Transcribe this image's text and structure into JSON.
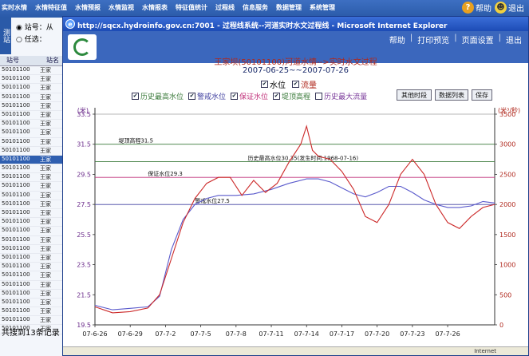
{
  "bg_app": {
    "nav": [
      "实时水情",
      "水情特征值",
      "水情预报",
      "水情监视",
      "水情报表",
      "特征值统计",
      "过程线",
      "信息服务",
      "数据管理",
      "系统管理"
    ],
    "help_label": "帮助",
    "exit_label": "退出",
    "side_tab": "测站",
    "radio_station": "站号：从",
    "radio_any": "任选：",
    "table_headers": [
      "站号",
      "站名"
    ],
    "rows": [
      {
        "code": "50101100",
        "name": "王家"
      },
      {
        "code": "50101100",
        "name": "王家"
      },
      {
        "code": "50101100",
        "name": "王家"
      },
      {
        "code": "50101100",
        "name": "王家"
      },
      {
        "code": "50101100",
        "name": "王家"
      },
      {
        "code": "50101100",
        "name": "王家"
      },
      {
        "code": "50101100",
        "name": "王家"
      },
      {
        "code": "50101100",
        "name": "王家"
      },
      {
        "code": "50101100",
        "name": "王家"
      },
      {
        "code": "50101100",
        "name": "王家"
      },
      {
        "code": "50101100",
        "name": "王家"
      },
      {
        "code": "50101100",
        "name": "王家"
      },
      {
        "code": "50101100",
        "name": "王家"
      },
      {
        "code": "50101100",
        "name": "王家"
      },
      {
        "code": "50101100",
        "name": "王家"
      },
      {
        "code": "50101100",
        "name": "王家"
      },
      {
        "code": "50101100",
        "name": "王家"
      },
      {
        "code": "50101100",
        "name": "王家"
      },
      {
        "code": "50101100",
        "name": "王家"
      },
      {
        "code": "50101100",
        "name": "王家"
      },
      {
        "code": "50101100",
        "name": "王家"
      },
      {
        "code": "50101100",
        "name": "王家"
      },
      {
        "code": "50101100",
        "name": "王家"
      },
      {
        "code": "50101100",
        "name": "王家"
      },
      {
        "code": "50101100",
        "name": "王家"
      },
      {
        "code": "50101100",
        "name": "王家"
      },
      {
        "code": "50101100",
        "name": "王家"
      },
      {
        "code": "50101100",
        "name": "王家"
      },
      {
        "code": "50101100",
        "name": "王家"
      },
      {
        "code": "50101100",
        "name": "王家"
      }
    ],
    "status": "共搜到13条记录"
  },
  "window": {
    "title": "http://sqcx.hydroinfo.gov.cn:7001 - 过程线系统--河道实时水文过程线 - Microsoft Internet Explorer",
    "links": [
      "帮助",
      "|",
      "打印预览",
      "|",
      "页面设置",
      "|",
      "退出"
    ],
    "status_zone": "Internet"
  },
  "controls": {
    "chart_title": "王家坝(50101100)河道水情-->实时水文过程",
    "date_range": "2007-06-25~~2007-07-26",
    "check_level": "水位",
    "check_flow": "流量",
    "check_hist_high": "历史最高水位",
    "check_warn": "警戒水位",
    "check_guar": "保证水位",
    "check_dike": "堤顶高程",
    "check_hist_max_flow": "历史最大流量",
    "btn_other": "其他时段",
    "btn_list": "数据列表",
    "btn_save": "保存"
  },
  "chart_data": {
    "type": "line",
    "x": [
      "07-6-26",
      "07-6-29",
      "07-7-2",
      "07-7-5",
      "07-7-8",
      "07-7-11",
      "07-7-14",
      "07-7-17",
      "07-7-20",
      "07-7-23",
      "07-7-26"
    ],
    "y_left_unit": "(米)",
    "y_right_unit": "(米³/秒)",
    "ylim_left": [
      19.5,
      33.5
    ],
    "ylim_right": [
      0,
      3500
    ],
    "yticks_left": [
      19.5,
      21.5,
      23.5,
      25.5,
      27.5,
      29.5,
      31.5,
      33.5
    ],
    "yticks_right": [
      0,
      500,
      1000,
      1500,
      2000,
      2500,
      3000,
      3500
    ],
    "reference_lines": [
      {
        "name": "堤顶高程",
        "value": 31.5,
        "label": "堤顶高程31.5",
        "color": "#3a7a3a"
      },
      {
        "name": "历史最高水位",
        "value": 30.35,
        "label": "历史最高水位30.35(发生时间:1968-07-16)",
        "color": "#3a7a3a"
      },
      {
        "name": "保证水位",
        "value": 29.3,
        "label": "保证水位29.3",
        "color": "#c0307a"
      },
      {
        "name": "警戒水位",
        "value": 27.5,
        "label": "警戒水位27.5",
        "color": "#4040a0"
      }
    ],
    "series": [
      {
        "name": "水位",
        "axis": "left",
        "color": "#5a5acc",
        "points": [
          [
            0,
            20.8
          ],
          [
            1.5,
            20.5
          ],
          [
            3,
            20.6
          ],
          [
            4.5,
            20.7
          ],
          [
            5.5,
            21.4
          ],
          [
            6.5,
            24.5
          ],
          [
            7.5,
            26.5
          ],
          [
            8.5,
            27.5
          ],
          [
            9.5,
            27.9
          ],
          [
            10.5,
            28.1
          ],
          [
            12,
            28.1
          ],
          [
            13.5,
            28.2
          ],
          [
            15,
            28.5
          ],
          [
            16.5,
            28.9
          ],
          [
            18,
            29.2
          ],
          [
            19,
            29.2
          ],
          [
            20,
            29.0
          ],
          [
            21,
            28.6
          ],
          [
            22,
            28.2
          ],
          [
            23,
            28.0
          ],
          [
            24,
            28.3
          ],
          [
            25,
            28.7
          ],
          [
            26,
            28.7
          ],
          [
            27,
            28.3
          ],
          [
            28,
            27.8
          ],
          [
            29,
            27.5
          ],
          [
            30,
            27.3
          ],
          [
            31,
            27.3
          ],
          [
            32,
            27.4
          ],
          [
            33,
            27.7
          ],
          [
            34,
            27.6
          ]
        ]
      },
      {
        "name": "流量",
        "axis": "right",
        "color": "#cc2a2a",
        "points": [
          [
            0,
            300
          ],
          [
            1.5,
            200
          ],
          [
            3,
            220
          ],
          [
            4.5,
            280
          ],
          [
            5.5,
            500
          ],
          [
            6.5,
            1100
          ],
          [
            7.5,
            1700
          ],
          [
            8.5,
            2100
          ],
          [
            9.5,
            2350
          ],
          [
            10.5,
            2450
          ],
          [
            11.5,
            2450
          ],
          [
            12.5,
            2150
          ],
          [
            13.5,
            2400
          ],
          [
            14.5,
            2200
          ],
          [
            15.5,
            2350
          ],
          [
            16.5,
            2700
          ],
          [
            17.5,
            3000
          ],
          [
            18,
            3300
          ],
          [
            18.5,
            2900
          ],
          [
            19,
            2800
          ],
          [
            20,
            2750
          ],
          [
            21,
            2550
          ],
          [
            22,
            2250
          ],
          [
            23,
            1800
          ],
          [
            24,
            1700
          ],
          [
            25,
            2000
          ],
          [
            26,
            2500
          ],
          [
            27,
            2750
          ],
          [
            28,
            2500
          ],
          [
            29,
            2000
          ],
          [
            30,
            1700
          ],
          [
            31,
            1600
          ],
          [
            32,
            1800
          ],
          [
            33,
            1950
          ],
          [
            34,
            2000
          ]
        ]
      }
    ]
  }
}
